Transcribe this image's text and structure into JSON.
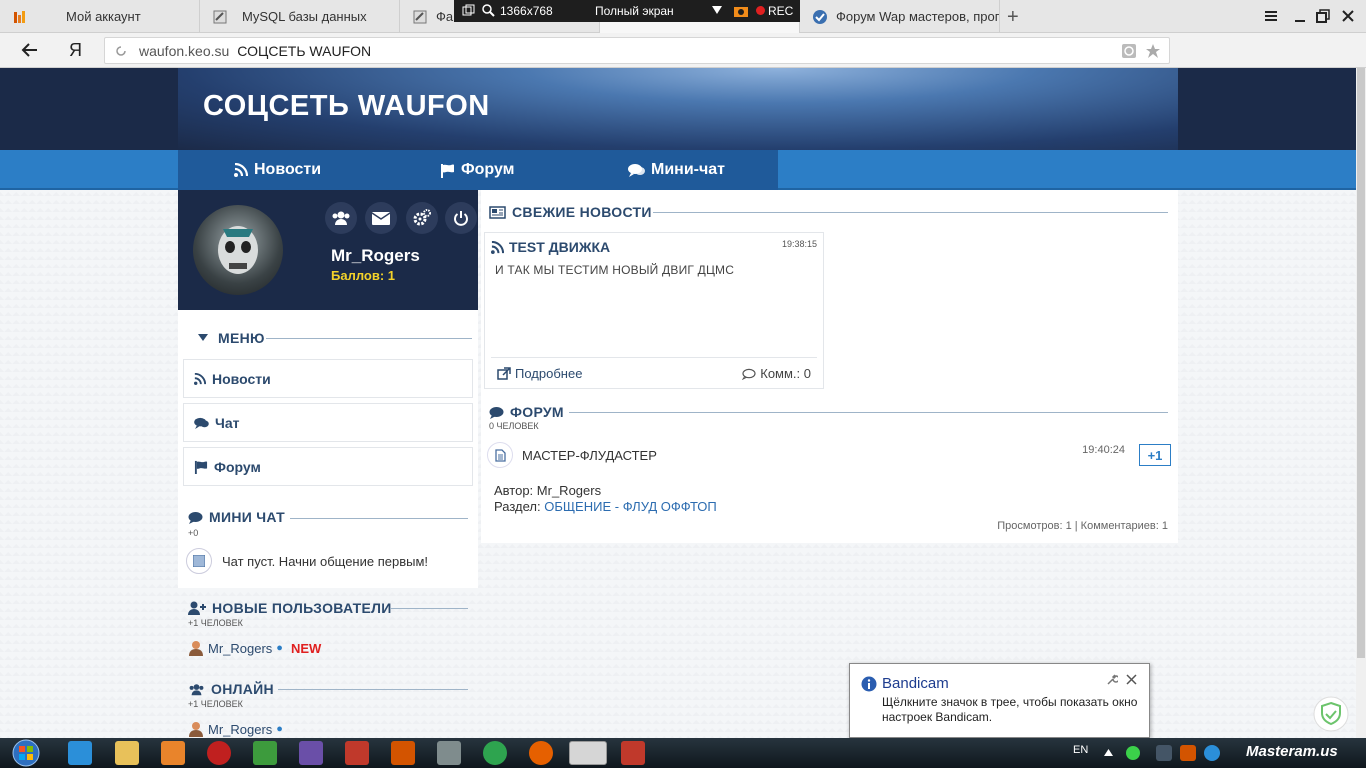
{
  "browser": {
    "tabs": [
      {
        "label": "Мой аккаунт"
      },
      {
        "label": "MySQL базы данных"
      },
      {
        "label": "Фа"
      },
      {
        "label": ""
      },
      {
        "label": "Форум Wap мастеров, прог"
      }
    ],
    "rec_bar": {
      "resolution": "1366x768",
      "mode": "Полный экран",
      "rec": "REC"
    },
    "address": {
      "domain": "waufon.keo.su",
      "page_title": "СОЦСЕТЬ WAUFON"
    },
    "yandex_logo": "Я"
  },
  "site": {
    "title": "СОЦСЕТЬ WAUFON",
    "nav": [
      {
        "label": "Новости",
        "icon": "rss-icon"
      },
      {
        "label": "Форум",
        "icon": "flag-icon"
      },
      {
        "label": "Мини-чат",
        "icon": "comments-icon"
      }
    ]
  },
  "profile": {
    "username": "Mr_Rogers",
    "points": "Баллов: 1",
    "icons": [
      "users-icon",
      "envelope-icon",
      "gears-icon",
      "power-icon"
    ]
  },
  "menu": {
    "heading": "МЕНЮ",
    "items": [
      {
        "label": "Новости",
        "icon": "rss-icon"
      },
      {
        "label": "Чат",
        "icon": "comments-icon"
      },
      {
        "label": "Форум",
        "icon": "flag-icon"
      }
    ]
  },
  "mini_chat": {
    "heading": "МИНИ ЧАТ",
    "sub": "+0",
    "empty": "Чат пуст. Начни общение первым!"
  },
  "new_users": {
    "heading": "НОВЫЕ ПОЛЬЗОВАТЕЛИ",
    "sub": "+1 ЧЕЛОВЕК",
    "user": "Mr_Rogers",
    "badge": "NEW"
  },
  "online": {
    "heading": "ОНЛАЙН",
    "sub": "+1 ЧЕЛОВЕК",
    "user": "Mr_Rogers"
  },
  "news": {
    "heading": "СВЕЖИЕ НОВОСТИ",
    "card": {
      "title": "TEST ДВИЖКА",
      "time": "19:38:15",
      "body": "И ТАК МЫ ТЕСТИМ НОВЫЙ ДВИГ ДЦМС",
      "more": "Подробнее",
      "comments": "Комм.: 0"
    }
  },
  "forum": {
    "heading": "ФОРУМ",
    "sub": "0 ЧЕЛОВЕК",
    "topic": {
      "title": "МАСТЕР-ФЛУДАСТЕР",
      "time": "19:40:24",
      "plus": "+1",
      "author_label": "Автор:",
      "author": "Mr_Rogers",
      "section_label": "Раздел:",
      "section": "ОБЩЕНИЕ",
      "subsection": "ФЛУД ОФФТОП",
      "stats": "Просмотров: 1 | Комментариев: 1"
    }
  },
  "bandicam": {
    "title": "Bandicam",
    "text": "Щёлкните значок в трее, чтобы показать окно настроек Bandicam."
  },
  "taskbar": {
    "lang": "EN",
    "brand": "Masteram.us"
  },
  "colors": {
    "accent": "#2c7ec6",
    "header_dark": "#1b2a48",
    "text_link": "#2c4a6e",
    "new_badge": "#e02020",
    "points": "#f3d22a"
  }
}
